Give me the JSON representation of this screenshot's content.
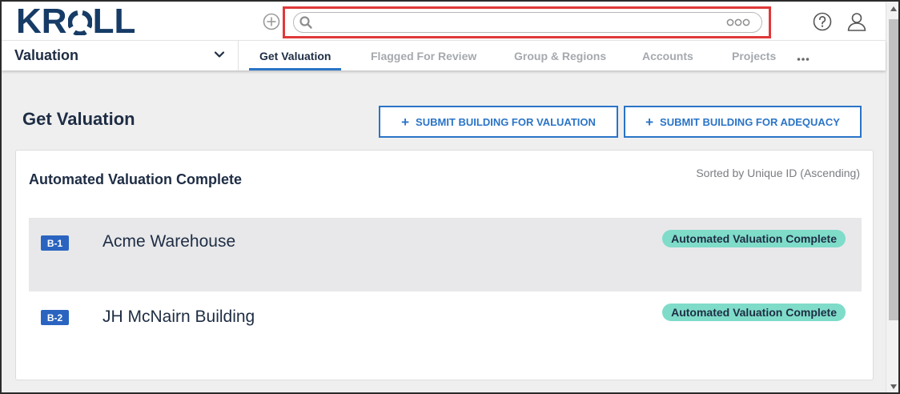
{
  "header": {
    "logo_text": "KROLL",
    "search": {
      "value": "",
      "placeholder": ""
    },
    "icons": {
      "add": "plus-circle-icon",
      "search": "search-icon",
      "options": "options-icon",
      "help": "help-icon",
      "user": "user-icon"
    }
  },
  "nav": {
    "module": "Valuation",
    "tabs": [
      {
        "label": "Get Valuation",
        "active": true
      },
      {
        "label": "Flagged For Review",
        "active": false
      },
      {
        "label": "Group & Regions",
        "active": false
      },
      {
        "label": "Accounts",
        "active": false
      },
      {
        "label": "Projects",
        "active": false
      }
    ],
    "more_label": "•••"
  },
  "page": {
    "title": "Get Valuation",
    "buttons": {
      "submit_valuation": "SUBMIT BUILDING FOR VALUATION",
      "submit_adequacy": "SUBMIT BUILDING FOR ADEQUACY"
    }
  },
  "card": {
    "title": "Automated Valuation Complete",
    "sort_note": "Sorted by Unique ID (Ascending)",
    "rows": [
      {
        "id": "B-1",
        "name": "Acme Warehouse",
        "status": "Automated Valuation Complete"
      },
      {
        "id": "B-2",
        "name": "JH McNairn Building",
        "status": "Automated Valuation Complete"
      }
    ]
  },
  "colors": {
    "brand_navy": "#163b66",
    "accent_blue": "#2a74c7",
    "badge_blue": "#2a64c0",
    "status_teal": "#7fdcc9",
    "highlight_red": "#e0393a"
  }
}
